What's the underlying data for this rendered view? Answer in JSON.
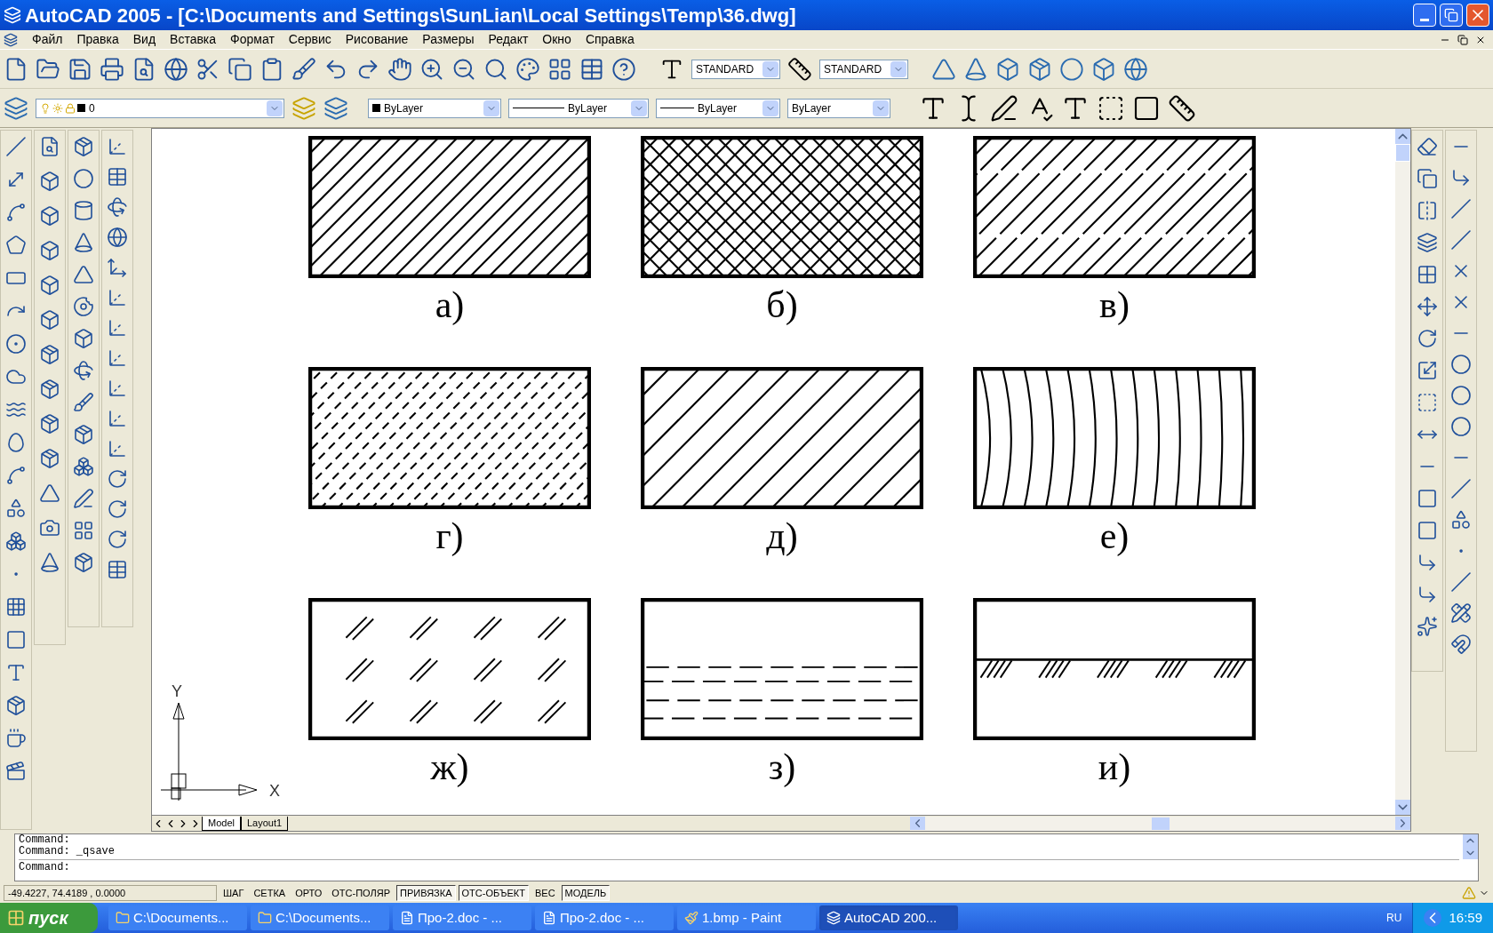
{
  "window": {
    "title": "AutoCAD 2005 - [C:\\Documents and Settings\\SunLian\\Local Settings\\Temp\\36.dwg]"
  },
  "menu": [
    "Файл",
    "Правка",
    "Вид",
    "Вставка",
    "Формат",
    "Сервис",
    "Рисование",
    "Размеры",
    "Редакт",
    "Окно",
    "Справка"
  ],
  "styles": {
    "text_style": "STANDARD",
    "dim_style": "STANDARD"
  },
  "properties": {
    "layer": "0",
    "color_control": "ByLayer",
    "linetype": "ByLayer",
    "lineweight": "ByLayer",
    "plot_style": "ByLayer"
  },
  "drawing": {
    "panels": [
      {
        "label": "а)",
        "kind": "diagonal"
      },
      {
        "label": "б)",
        "kind": "crosshatch"
      },
      {
        "label": "в)",
        "kind": "broken-diagonal"
      },
      {
        "label": "г)",
        "kind": "dashed-diagonal"
      },
      {
        "label": "д)",
        "kind": "wide-diagonal"
      },
      {
        "label": "е)",
        "kind": "arcs"
      },
      {
        "label": "ж)",
        "kind": "stroke-pairs"
      },
      {
        "label": "з)",
        "kind": "dashed-horizontal"
      },
      {
        "label": "и)",
        "kind": "ground-line"
      }
    ],
    "ucs": {
      "x_label": "X",
      "y_label": "Y"
    }
  },
  "layout_tabs": [
    {
      "label": "Model",
      "selected": true
    },
    {
      "label": "Layout1",
      "selected": false
    }
  ],
  "command_line": {
    "history": [
      "Command:",
      "Command: _qsave"
    ],
    "prompt": "Command:"
  },
  "status_bar": {
    "coordinates": "-49.4227, 74.4189 , 0.0000",
    "toggles": [
      {
        "label": "ШАГ",
        "on": false
      },
      {
        "label": "СЕТКА",
        "on": false
      },
      {
        "label": "ОРТО",
        "on": false
      },
      {
        "label": "ОТС-ПОЛЯР",
        "on": false
      },
      {
        "label": "ПРИВЯЗКА",
        "on": true
      },
      {
        "label": "ОТС-ОБЪЕКТ",
        "on": true
      },
      {
        "label": "ВЕС",
        "on": false
      },
      {
        "label": "МОДЕЛЬ",
        "on": true
      }
    ]
  },
  "taskbar": {
    "start": "пуск",
    "tasks": [
      {
        "label": "C:\\Documents...",
        "kind": "folder",
        "selected": false
      },
      {
        "label": "C:\\Documents...",
        "kind": "folder",
        "selected": false
      },
      {
        "label": "Про-2.doc - ...",
        "kind": "word",
        "selected": false
      },
      {
        "label": "Про-2.doc - ...",
        "kind": "word",
        "selected": false
      },
      {
        "label": "1.bmp - Paint",
        "kind": "paint",
        "selected": false
      },
      {
        "label": "AutoCAD 200...",
        "kind": "autocad",
        "selected": true
      }
    ],
    "language": "RU",
    "clock": "16:59"
  }
}
